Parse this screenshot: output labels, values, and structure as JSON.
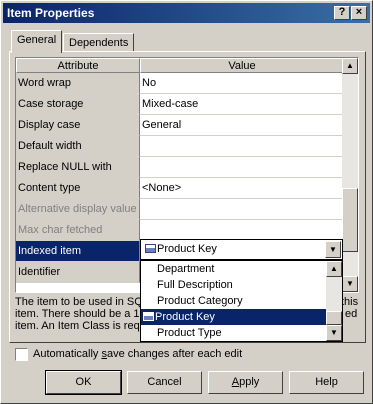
{
  "window": {
    "title": "Item Properties",
    "help_glyph": "?",
    "close_glyph": "×"
  },
  "tabs": [
    {
      "label": "General"
    },
    {
      "label": "Dependents"
    }
  ],
  "grid": {
    "headers": {
      "attribute": "Attribute",
      "value": "Value"
    },
    "rows": [
      {
        "attribute": "Word wrap",
        "value": "No"
      },
      {
        "attribute": "Case storage",
        "value": "Mixed-case"
      },
      {
        "attribute": "Display case",
        "value": "General"
      },
      {
        "attribute": "Default width",
        "value": ""
      },
      {
        "attribute": "Replace NULL with",
        "value": ""
      },
      {
        "attribute": "Content type",
        "value": "<None>"
      },
      {
        "attribute": "Alternative display value",
        "value": ""
      },
      {
        "attribute": "Max char fetched",
        "value": ""
      },
      {
        "attribute": "Indexed item",
        "value": ""
      },
      {
        "attribute": "Identifier",
        "value": ""
      }
    ],
    "combo_value": "Product Key"
  },
  "dropdown": {
    "options": [
      "Department",
      "Full Description",
      "Product Category",
      "Product Key",
      "Product Type"
    ],
    "selected": "Product Key"
  },
  "description": {
    "lines": [
      "The item to be used in SQL",
      "item. There should be a 1:",
      "item. An Item Class is requ"
    ],
    "right_fragments": [
      "this",
      "ed"
    ]
  },
  "checkbox": {
    "prefix": "Automatically ",
    "accel": "s",
    "suffix": "ave changes after each edit",
    "checked": false
  },
  "buttons": {
    "ok": "OK",
    "cancel": "Cancel",
    "apply_accel": "A",
    "apply_rest": "pply",
    "help": "Help"
  },
  "icons": {
    "scroll_up": "▲",
    "scroll_down": "▼",
    "combo_arrow": "▼"
  }
}
